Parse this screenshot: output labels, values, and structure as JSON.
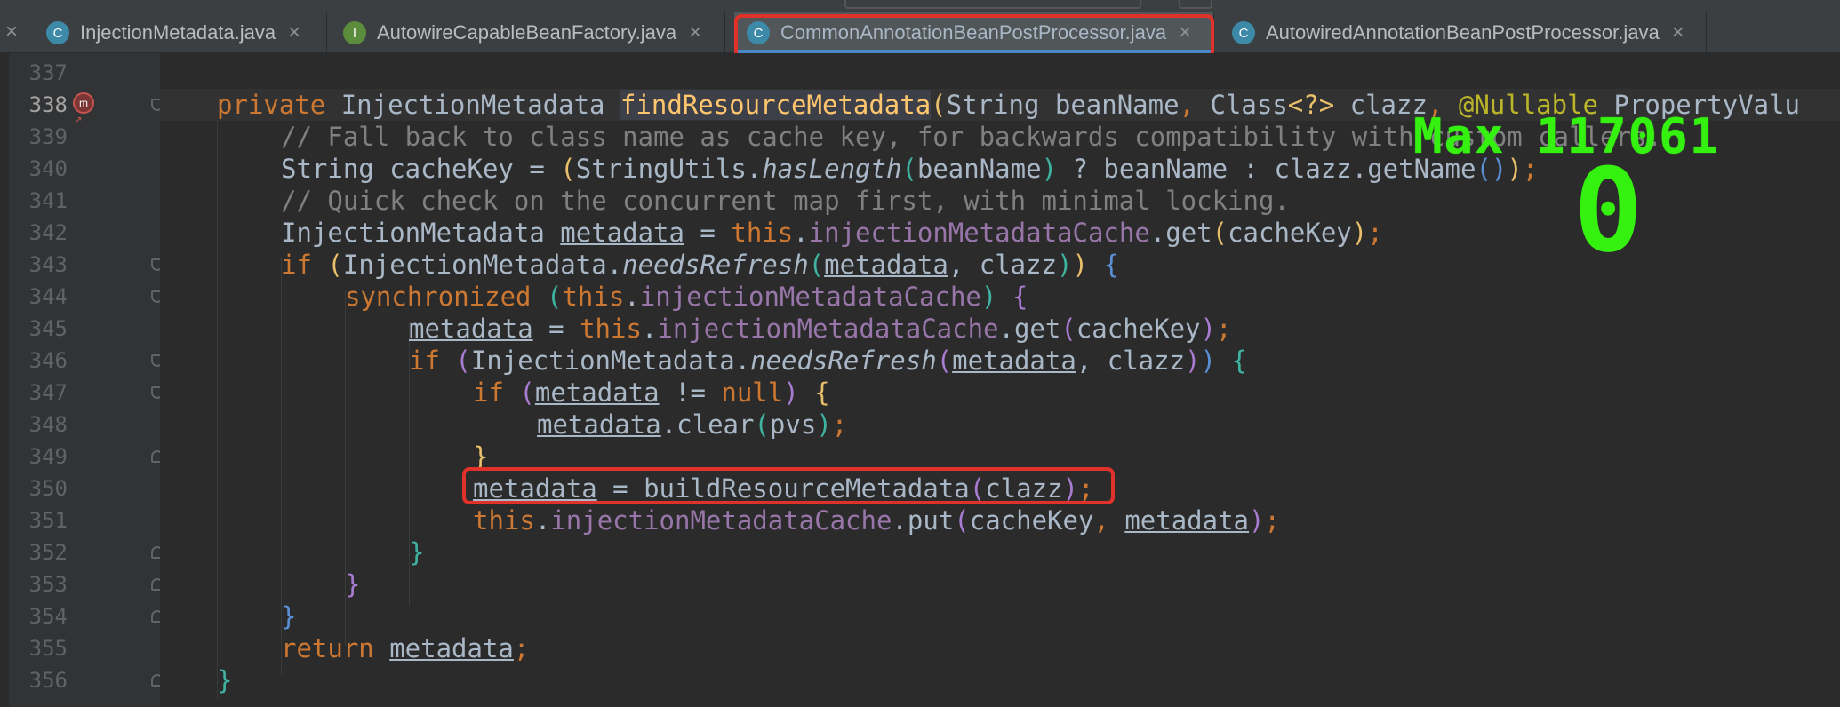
{
  "tabs": [
    {
      "name": "InjectionMetadata.java",
      "icon": "C",
      "active": false
    },
    {
      "name": "AutowireCapableBeanFactory.java",
      "icon": "I",
      "active": false
    },
    {
      "name": "CommonAnnotationBeanPostProcessor.java",
      "icon": "C",
      "active": true
    },
    {
      "name": "AutowiredAnnotationBeanPostProcessor.java",
      "icon": "C",
      "active": false
    }
  ],
  "tab_close_glyph": "×",
  "line_numbers": [
    "337",
    "338",
    "339",
    "340",
    "341",
    "342",
    "343",
    "344",
    "345",
    "346",
    "347",
    "348",
    "349",
    "350",
    "351",
    "352",
    "353",
    "354",
    "355",
    "356"
  ],
  "current_line": "338",
  "overlay": {
    "max_text": "Max 117061",
    "counter": "0"
  },
  "colors": {
    "keyword": "#cc7832",
    "field": "#9876aa",
    "method": "#ffc66d",
    "comment": "#808080",
    "highlight_box": "#e0312a",
    "overlay": "#35f10f"
  },
  "code": {
    "l338": {
      "kw_private": "private ",
      "type": "InjectionMetadata ",
      "method": "findResourceMetadata",
      "p_open": "(",
      "params": "String beanName",
      "comma1": ", ",
      "param2": "Class",
      "generic": "<?>",
      "param2b": " clazz",
      "comma2": ", ",
      "annotation": "@Nullable",
      "param3": " PropertyValu"
    },
    "l339": {
      "comment": "// Fall back to class name as cache key, for backwards compatibility with custom callers."
    },
    "l340": {
      "a": "String cacheKey = ",
      "p": "(",
      "b": "StringUtils.",
      "m": "hasLength",
      "p2": "(",
      "c": "beanName",
      "p3": ")",
      "d": " ? beanName : clazz.getName",
      "p4": "()",
      "p5": ")",
      "e": ";"
    },
    "l341": {
      "comment": "// Quick check on the concurrent map first, with minimal locking."
    },
    "l342": {
      "a": "InjectionMetadata ",
      "v": "metadata",
      "b": " = ",
      "t": "this",
      "c": ".",
      "f": "injectionMetadataCache",
      "d": ".get",
      "p": "(",
      "e": "cacheKey",
      "p2": ")",
      "s": ";"
    },
    "l343": {
      "kw": "if ",
      "p": "(",
      "a": "InjectionMetadata.",
      "m": "needsRefresh",
      "p2": "(",
      "v": "metadata",
      "b": ", clazz",
      "p3": ")",
      "p4": ")",
      "c": " ",
      "br": "{"
    },
    "l344": {
      "kw": "synchronized ",
      "p": "(",
      "t": "this",
      "c": ".",
      "f": "injectionMetadataCache",
      "p2": ")",
      "s": " ",
      "br": "{"
    },
    "l345": {
      "v": "metadata",
      "a": " = ",
      "t": "this",
      "c": ".",
      "f": "injectionMetadataCache",
      "d": ".get",
      "p": "(",
      "e": "cacheKey",
      "p2": ")",
      "s": ";"
    },
    "l346": {
      "kw": "if ",
      "p": "(",
      "a": "InjectionMetadata.",
      "m": "needsRefresh",
      "p2": "(",
      "v": "metadata",
      "b": ", clazz",
      "p3": ")",
      "p4": ")",
      "c": " ",
      "br": "{"
    },
    "l347": {
      "kw": "if ",
      "p": "(",
      "v": "metadata",
      "a": " != ",
      "n": "null",
      "p2": ")",
      "c": " ",
      "br": "{"
    },
    "l348": {
      "v": "metadata",
      "a": ".clear",
      "p": "(",
      "b": "pvs",
      "p2": ")",
      "s": ";"
    },
    "l349": {
      "br": "}"
    },
    "l350": {
      "v": "metadata",
      "a": " = buildResourceMetadata",
      "p": "(",
      "b": "clazz",
      "p2": ")",
      "s": ";"
    },
    "l351": {
      "t": "this",
      "c": ".",
      "f": "injectionMetadataCache",
      "d": ".put",
      "p": "(",
      "a": "cacheKey",
      "cm": ", ",
      "v": "metadata",
      "p2": ")",
      "s": ";"
    },
    "l352": {
      "br": "}"
    },
    "l353": {
      "br": "}"
    },
    "l354": {
      "br": "}"
    },
    "l355": {
      "kw": "return ",
      "v": "metadata",
      "s": ";"
    },
    "l356": {
      "br": "}"
    }
  }
}
